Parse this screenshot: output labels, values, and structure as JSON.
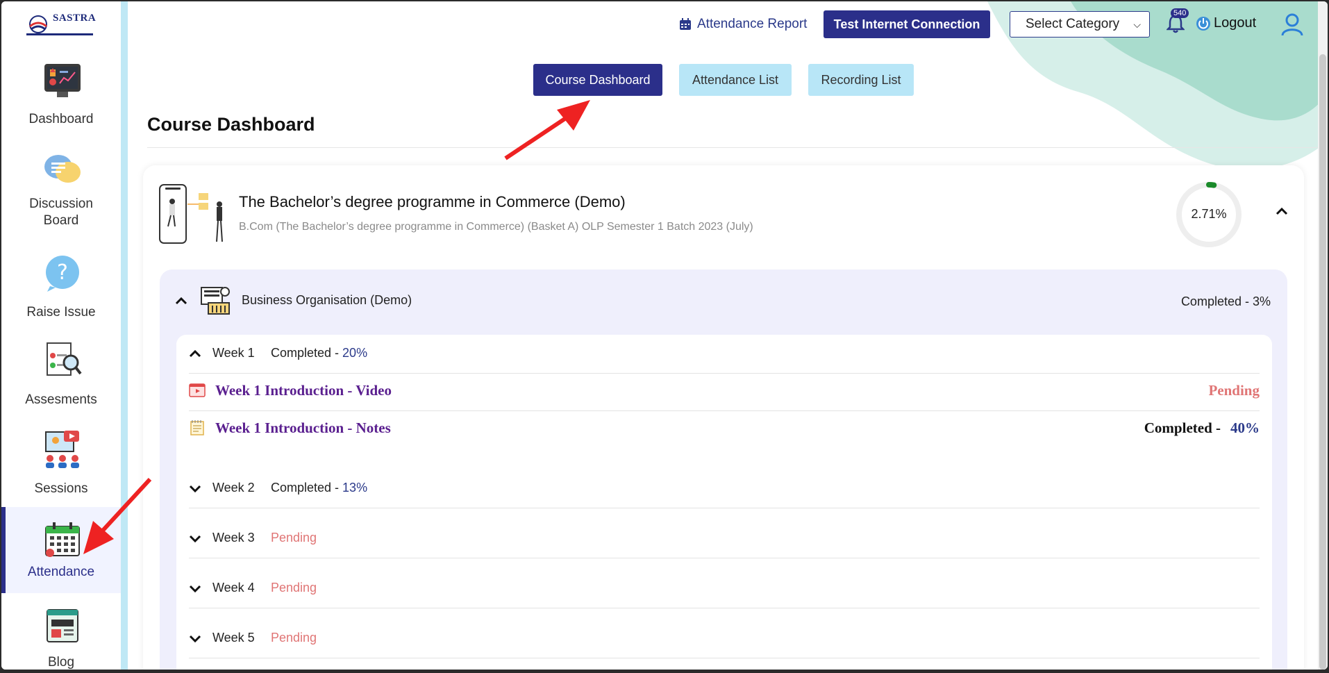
{
  "app": {
    "logo_text": "SASTRA"
  },
  "sidebar": {
    "items": [
      {
        "label": "Dashboard"
      },
      {
        "label": "Discussion\nBoard"
      },
      {
        "label": "Raise Issue"
      },
      {
        "label": "Assesments"
      },
      {
        "label": "Sessions"
      },
      {
        "label": "Attendance",
        "active": true
      },
      {
        "label": "Blog"
      }
    ]
  },
  "header": {
    "attendance_report": "Attendance Report",
    "test_connection": "Test Internet Connection",
    "select_category": "Select Category",
    "notification_count": "540",
    "logout": "Logout"
  },
  "tabs": [
    {
      "label": "Course Dashboard",
      "active": true
    },
    {
      "label": "Attendance List",
      "active": false
    },
    {
      "label": "Recording List",
      "active": false
    }
  ],
  "page_title": "Course Dashboard",
  "course": {
    "title": "The Bachelor’s degree programme in Commerce (Demo)",
    "subtitle": "B.Com (The Bachelor’s degree programme in Commerce) (Basket A) OLP Semester 1 Batch 2023 (July)",
    "progress_text": "2.71%",
    "progress_value": 2.71,
    "subject": {
      "name": "Business Organisation (Demo)",
      "completed": "Completed - 3%"
    },
    "weeks": [
      {
        "label": "Week 1",
        "status_label": "Completed - ",
        "percent": "20%"
      },
      {
        "label": "Week 2",
        "status_label": "Completed - ",
        "percent": "13%"
      },
      {
        "label": "Week 3",
        "status": "Pending"
      },
      {
        "label": "Week 4",
        "status": "Pending"
      },
      {
        "label": "Week 5",
        "status": "Pending"
      }
    ],
    "lessons": [
      {
        "name": "Week 1 Introduction - Video",
        "status": "Pending",
        "icon": "video-icon"
      },
      {
        "name": "Week 1 Introduction - Notes",
        "status_label": "Completed -",
        "percent": "40%",
        "icon": "notes-icon"
      }
    ]
  },
  "colors": {
    "primary": "#2b2f8a",
    "tab_inactive": "#b8e6f7",
    "pending": "#e07575",
    "lesson": "#5a1f8f",
    "progress": "#1a8a2a",
    "panel": "#efeffc"
  }
}
